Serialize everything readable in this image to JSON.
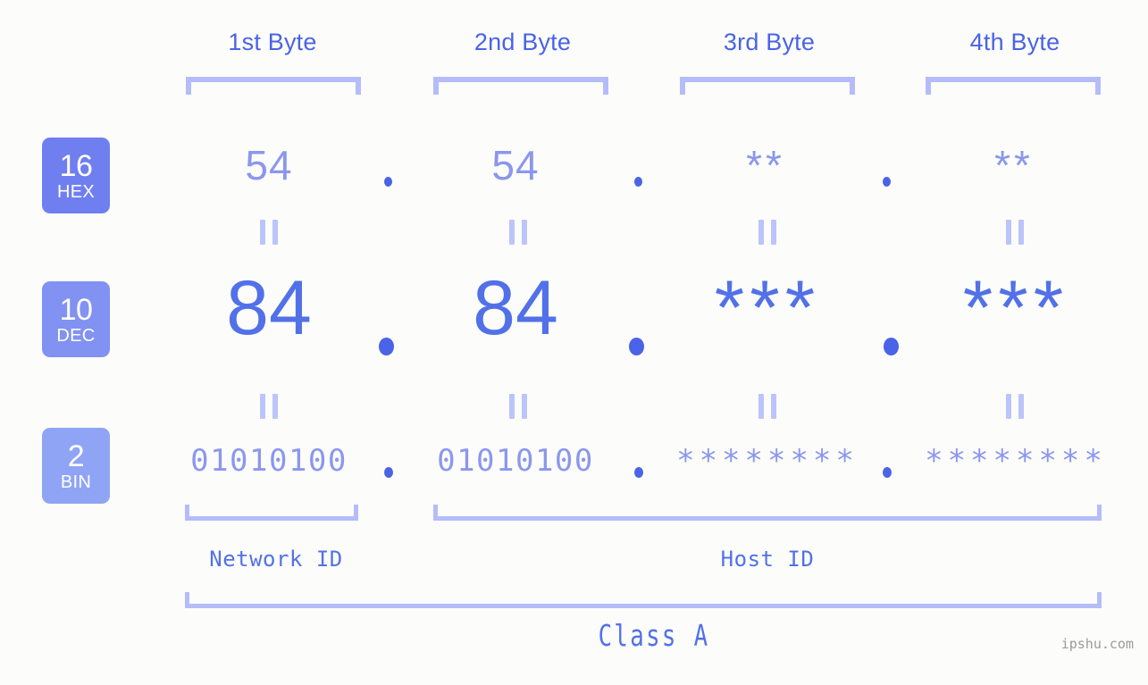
{
  "meta": {
    "background_color": "#fcfdfa",
    "accent_color": "#5271e8",
    "light_accent_color": "#8b97ee",
    "bracket_color": "#b4bcfa",
    "watermark_color": "#9a9a9a"
  },
  "header": {
    "byte_labels": [
      {
        "label": "1st Byte"
      },
      {
        "label": "2nd Byte"
      },
      {
        "label": "3rd Byte"
      },
      {
        "label": "4th Byte"
      }
    ]
  },
  "rows": [
    {
      "id": "hex",
      "badge": {
        "number": "16",
        "name": "HEX",
        "color": "#6f7ff0"
      },
      "values": [
        "54",
        "54",
        "**",
        "**"
      ],
      "separator": "."
    },
    {
      "id": "dec",
      "badge": {
        "number": "10",
        "name": "DEC",
        "color": "#8192f2"
      },
      "values": [
        "84",
        "84",
        "***",
        "***"
      ],
      "separator": "."
    },
    {
      "id": "bin",
      "badge": {
        "number": "2",
        "name": "BIN",
        "color": "#8fa4f5"
      },
      "values": [
        "01010100",
        "01010100",
        "********",
        "********"
      ],
      "separator": "."
    }
  ],
  "equals_markers": {
    "glyph": "||",
    "count_per_row": 4
  },
  "footer": {
    "network_id_label": "Network ID",
    "host_id_label": "Host ID",
    "class_label": "Class A",
    "watermark": "ipshu.com"
  }
}
